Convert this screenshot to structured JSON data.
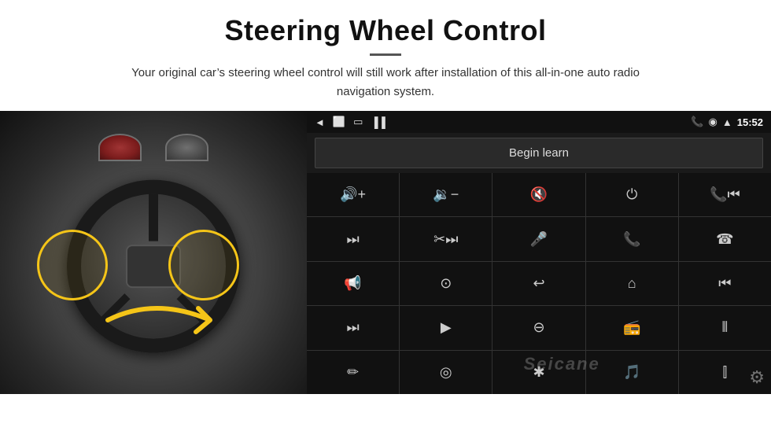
{
  "header": {
    "title": "Steering Wheel Control",
    "divider": true,
    "subtitle": "Your original car’s steering wheel control will still work after installation of this all-in-one auto radio navigation system."
  },
  "status_bar": {
    "back_icon": "◄",
    "home_icon": "□",
    "square_icon": "□",
    "signal_icon": "📶",
    "phone_icon": "📞",
    "location_icon": "⦿",
    "wifi_icon": "▲",
    "time": "15:52"
  },
  "begin_learn": {
    "label": "Begin learn"
  },
  "controls": [
    {
      "icon": "🔊+",
      "symbol": "vol_up",
      "unicode": "🔊"
    },
    {
      "icon": "🔉-",
      "symbol": "vol_down",
      "unicode": "🔉"
    },
    {
      "icon": "🔈×",
      "symbol": "mute",
      "unicode": "🔇"
    },
    {
      "icon": "⏻",
      "symbol": "power",
      "unicode": "⏻"
    },
    {
      "icon": "☎⏮",
      "symbol": "phone_prev",
      "unicode": "☎"
    },
    {
      "icon": "⏭",
      "symbol": "next_track",
      "unicode": "⏭"
    },
    {
      "icon": "☎⏭",
      "symbol": "phone_next",
      "unicode": "⏩"
    },
    {
      "icon": "🎤",
      "symbol": "mic",
      "unicode": "🎤"
    },
    {
      "icon": "☎",
      "symbol": "call",
      "unicode": "☎"
    },
    {
      "icon": "↪",
      "symbol": "end_call",
      "unicode": "☏"
    },
    {
      "icon": "📢",
      "symbol": "speaker",
      "unicode": "📢"
    },
    {
      "icon": "⦿",
      "symbol": "360",
      "unicode": "⦿"
    },
    {
      "icon": "↩",
      "symbol": "back",
      "unicode": "↩"
    },
    {
      "icon": "⌂",
      "symbol": "home",
      "unicode": "⌂"
    },
    {
      "icon": "⏮⏮",
      "symbol": "prev_track2",
      "unicode": "⏮"
    },
    {
      "icon": "⏭⏭",
      "symbol": "next_track2",
      "unicode": "⏭"
    },
    {
      "icon": "▶",
      "symbol": "nav",
      "unicode": "▶"
    },
    {
      "icon": "⧄",
      "symbol": "source",
      "unicode": "⧄"
    },
    {
      "icon": "📻",
      "symbol": "radio",
      "unicode": "📻"
    },
    {
      "icon": "⦀",
      "symbol": "eq",
      "unicode": "⦀"
    },
    {
      "icon": "✏",
      "symbol": "pen",
      "unicode": "✏"
    },
    {
      "icon": "⦿",
      "symbol": "settings2",
      "unicode": "⦿"
    },
    {
      "icon": "★",
      "symbol": "bt",
      "unicode": "★"
    },
    {
      "icon": "♫",
      "symbol": "music",
      "unicode": "♫"
    },
    {
      "icon": "⦀",
      "symbol": "eq2",
      "unicode": "⦀"
    }
  ],
  "watermark": "Seicane"
}
